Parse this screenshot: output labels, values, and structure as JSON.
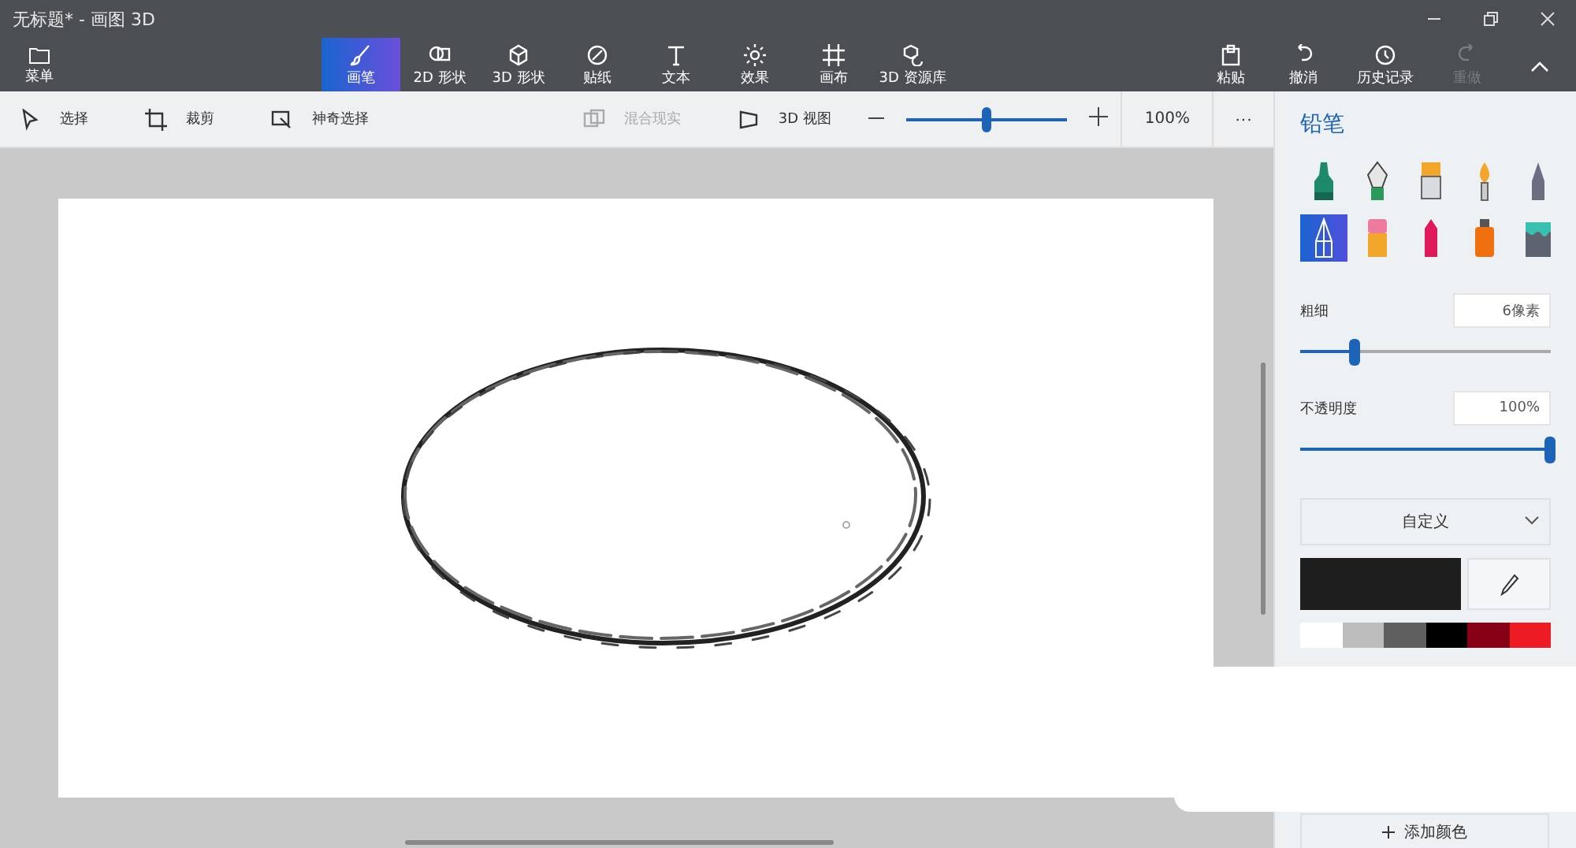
{
  "window": {
    "title": "无标题* - 画图 3D"
  },
  "ribbon": {
    "menu": {
      "label": "菜单"
    },
    "tools": [
      {
        "kind": "brush",
        "label": "画笔",
        "selected": true
      },
      {
        "kind": "shape2d",
        "label": "2D 形状",
        "selected": false
      },
      {
        "kind": "shape3d",
        "label": "3D 形状",
        "selected": false
      },
      {
        "kind": "sticker",
        "label": "贴纸",
        "selected": false
      },
      {
        "kind": "text",
        "label": "文本",
        "selected": false
      },
      {
        "kind": "effects",
        "label": "效果",
        "selected": false
      },
      {
        "kind": "canvas",
        "label": "画布",
        "selected": false
      },
      {
        "kind": "library",
        "label": "3D 资源库",
        "selected": false
      }
    ],
    "actions": [
      {
        "kind": "paste",
        "label": "粘贴",
        "disabled": false
      },
      {
        "kind": "undo",
        "label": "撤消",
        "disabled": false
      },
      {
        "kind": "history",
        "label": "历史记录",
        "disabled": false
      },
      {
        "kind": "redo",
        "label": "重做",
        "disabled": true
      }
    ]
  },
  "toolbar": {
    "items": [
      {
        "kind": "select",
        "label": "选择",
        "disabled": false
      },
      {
        "kind": "crop",
        "label": "裁剪",
        "disabled": false
      },
      {
        "kind": "magic",
        "label": "神奇选择",
        "disabled": false
      }
    ],
    "mixed_reality": {
      "label": "混合现实",
      "disabled": true
    },
    "view_3d": {
      "label": "3D 视图"
    },
    "zoom": {
      "level": 0.5,
      "reading": "100%"
    },
    "more": "···"
  },
  "panel": {
    "title": "铅笔",
    "brushes": [
      {
        "kind": "marker",
        "selected": false
      },
      {
        "kind": "pen",
        "selected": false
      },
      {
        "kind": "oil",
        "selected": false
      },
      {
        "kind": "watercolor",
        "selected": false
      },
      {
        "kind": "pixel",
        "selected": false
      },
      {
        "kind": "pencil",
        "selected": true
      },
      {
        "kind": "eraser",
        "selected": false
      },
      {
        "kind": "crayon",
        "selected": false
      },
      {
        "kind": "spray",
        "selected": false
      },
      {
        "kind": "fill",
        "selected": false
      }
    ],
    "thickness": {
      "label": "粗细",
      "value": "6像素",
      "level": 0.22
    },
    "opacity": {
      "label": "不透明度",
      "value": "100%",
      "level": 1
    },
    "color_mode": {
      "value": "自定义"
    },
    "palette": [
      {
        "color": "#ffffff"
      },
      {
        "color": "#bdbdbd"
      },
      {
        "color": "#5f5f5f"
      },
      {
        "color": "#000000"
      },
      {
        "color": "#880015"
      },
      {
        "color": "#ed1c24"
      }
    ],
    "add_color": "添加颜色"
  }
}
